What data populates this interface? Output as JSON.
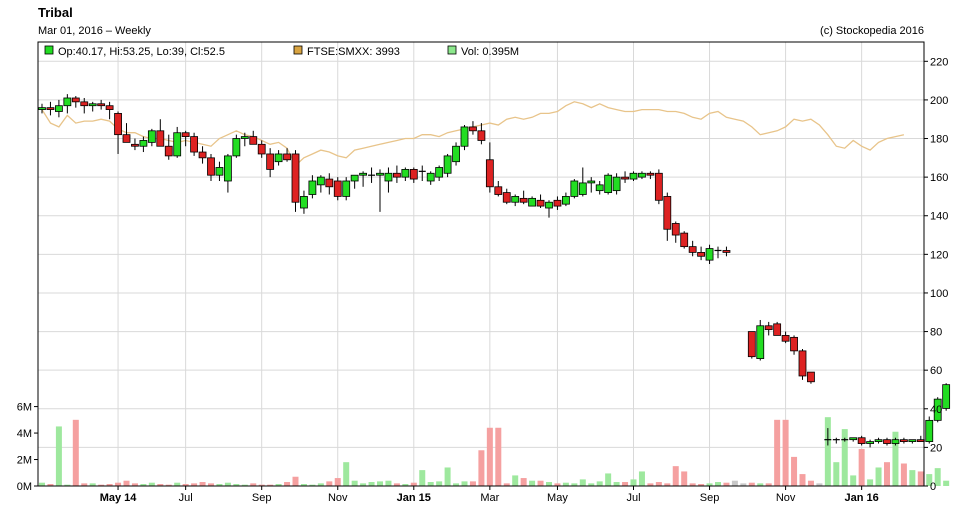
{
  "header": {
    "title": "Tribal",
    "subtitle": "Mar 01, 2016 – Weekly",
    "copyright": "(c) Stockopedia 2016"
  },
  "legend": [
    {
      "label": "Op:40.17, Hi:53.25, Lo:39, Cl:52.5",
      "color": "#22dd22"
    },
    {
      "label": "FTSE:SMXX: 3993",
      "color": "#d9a441"
    },
    {
      "label": "Vol: 0.395M",
      "color": "#8ce88c"
    }
  ],
  "colors": {
    "up": "#22dd22",
    "down": "#dd2222",
    "index_line": "#e8c48a",
    "vol_up": "#9ee89e",
    "vol_down": "#f5a0a0",
    "vol_neutral": "#c8c8c8",
    "grid": "#d9d9d9"
  },
  "chart_data": {
    "type": "candlestick",
    "price_axis": {
      "min": 0,
      "max": 230,
      "ticks": [
        0,
        20,
        40,
        60,
        80,
        100,
        120,
        140,
        160,
        180,
        200,
        220
      ]
    },
    "volume_axis": {
      "min": 0,
      "max": 6.8,
      "ticks": [
        0,
        2,
        4,
        6
      ],
      "tick_labels": [
        "0M",
        "2M",
        "4M",
        "6M"
      ]
    },
    "x_axis": {
      "labels": [
        {
          "label": "May 14",
          "week": 9,
          "bold": true
        },
        {
          "label": "Jul",
          "week": 17,
          "bold": false
        },
        {
          "label": "Sep",
          "week": 26,
          "bold": false
        },
        {
          "label": "Nov",
          "week": 35,
          "bold": false
        },
        {
          "label": "Jan 15",
          "week": 44,
          "bold": true
        },
        {
          "label": "Mar",
          "week": 53,
          "bold": false
        },
        {
          "label": "May",
          "week": 61,
          "bold": false
        },
        {
          "label": "Jul",
          "week": 70,
          "bold": false
        },
        {
          "label": "Sep",
          "week": 79,
          "bold": false
        },
        {
          "label": "Nov",
          "week": 88,
          "bold": false
        },
        {
          "label": "Jan 16",
          "week": 97,
          "bold": true
        }
      ]
    },
    "candles": [
      {
        "o": 195,
        "h": 198,
        "l": 193,
        "c": 196
      },
      {
        "o": 196,
        "h": 199,
        "l": 192,
        "c": 195
      },
      {
        "o": 194,
        "h": 200,
        "l": 191,
        "c": 197
      },
      {
        "o": 197,
        "h": 203,
        "l": 193,
        "c": 201
      },
      {
        "o": 201,
        "h": 202,
        "l": 196,
        "c": 199
      },
      {
        "o": 199,
        "h": 201,
        "l": 193,
        "c": 197
      },
      {
        "o": 197,
        "h": 199,
        "l": 194,
        "c": 198
      },
      {
        "o": 198,
        "h": 200,
        "l": 195,
        "c": 197
      },
      {
        "o": 197,
        "h": 199,
        "l": 190,
        "c": 195
      },
      {
        "o": 193,
        "h": 194,
        "l": 172,
        "c": 182
      },
      {
        "o": 182,
        "h": 188,
        "l": 179,
        "c": 178
      },
      {
        "o": 177,
        "h": 180,
        "l": 174,
        "c": 176
      },
      {
        "o": 176,
        "h": 181,
        "l": 173,
        "c": 179
      },
      {
        "o": 178,
        "h": 185,
        "l": 176,
        "c": 184
      },
      {
        "o": 184,
        "h": 190,
        "l": 178,
        "c": 176
      },
      {
        "o": 176,
        "h": 182,
        "l": 169,
        "c": 171
      },
      {
        "o": 171,
        "h": 186,
        "l": 170,
        "c": 183
      },
      {
        "o": 183,
        "h": 184,
        "l": 176,
        "c": 181
      },
      {
        "o": 181,
        "h": 183,
        "l": 171,
        "c": 173
      },
      {
        "o": 173,
        "h": 176,
        "l": 167,
        "c": 170
      },
      {
        "o": 170,
        "h": 172,
        "l": 158,
        "c": 161
      },
      {
        "o": 161,
        "h": 168,
        "l": 158,
        "c": 165
      },
      {
        "o": 158,
        "h": 172,
        "l": 152,
        "c": 171
      },
      {
        "o": 171,
        "h": 182,
        "l": 170,
        "c": 180
      },
      {
        "o": 180,
        "h": 183,
        "l": 176,
        "c": 181
      },
      {
        "o": 181,
        "h": 184,
        "l": 177,
        "c": 177
      },
      {
        "o": 177,
        "h": 179,
        "l": 170,
        "c": 172
      },
      {
        "o": 172,
        "h": 175,
        "l": 160,
        "c": 164
      },
      {
        "o": 168,
        "h": 174,
        "l": 166,
        "c": 172
      },
      {
        "o": 172,
        "h": 175,
        "l": 168,
        "c": 169
      },
      {
        "o": 172,
        "h": 174,
        "l": 142,
        "c": 147
      },
      {
        "o": 144,
        "h": 153,
        "l": 141,
        "c": 150
      },
      {
        "o": 151,
        "h": 161,
        "l": 149,
        "c": 158
      },
      {
        "o": 156,
        "h": 161,
        "l": 152,
        "c": 160
      },
      {
        "o": 159,
        "h": 162,
        "l": 151,
        "c": 155
      },
      {
        "o": 158,
        "h": 160,
        "l": 148,
        "c": 150
      },
      {
        "o": 150,
        "h": 160,
        "l": 148,
        "c": 158
      },
      {
        "o": 158,
        "h": 161,
        "l": 154,
        "c": 161
      },
      {
        "o": 161,
        "h": 163,
        "l": 155,
        "c": 162
      },
      {
        "o": 161,
        "h": 165,
        "l": 157,
        "c": 161
      },
      {
        "o": 161,
        "h": 164,
        "l": 142,
        "c": 162
      },
      {
        "o": 158,
        "h": 165,
        "l": 152,
        "c": 162
      },
      {
        "o": 162,
        "h": 166,
        "l": 157,
        "c": 160
      },
      {
        "o": 160,
        "h": 165,
        "l": 158,
        "c": 164
      },
      {
        "o": 164,
        "h": 165,
        "l": 157,
        "c": 159
      },
      {
        "o": 163,
        "h": 166,
        "l": 158,
        "c": 163
      },
      {
        "o": 158,
        "h": 163,
        "l": 156,
        "c": 162
      },
      {
        "o": 160,
        "h": 166,
        "l": 158,
        "c": 165
      },
      {
        "o": 162,
        "h": 172,
        "l": 160,
        "c": 171
      },
      {
        "o": 168,
        "h": 178,
        "l": 166,
        "c": 176
      },
      {
        "o": 176,
        "h": 187,
        "l": 174,
        "c": 186
      },
      {
        "o": 186,
        "h": 189,
        "l": 182,
        "c": 184
      },
      {
        "o": 184,
        "h": 188,
        "l": 177,
        "c": 179
      },
      {
        "o": 169,
        "h": 178,
        "l": 152,
        "c": 155
      },
      {
        "o": 155,
        "h": 158,
        "l": 150,
        "c": 151
      },
      {
        "o": 152,
        "h": 154,
        "l": 146,
        "c": 147
      },
      {
        "o": 147,
        "h": 151,
        "l": 145,
        "c": 150
      },
      {
        "o": 149,
        "h": 153,
        "l": 146,
        "c": 147
      },
      {
        "o": 145,
        "h": 150,
        "l": 145,
        "c": 149
      },
      {
        "o": 148,
        "h": 151,
        "l": 144,
        "c": 145
      },
      {
        "o": 144,
        "h": 148,
        "l": 139,
        "c": 147
      },
      {
        "o": 148,
        "h": 150,
        "l": 143,
        "c": 145
      },
      {
        "o": 146,
        "h": 152,
        "l": 145,
        "c": 150
      },
      {
        "o": 150,
        "h": 159,
        "l": 149,
        "c": 158
      },
      {
        "o": 151,
        "h": 165,
        "l": 150,
        "c": 157
      },
      {
        "o": 157,
        "h": 160,
        "l": 152,
        "c": 158
      },
      {
        "o": 153,
        "h": 158,
        "l": 151,
        "c": 156
      },
      {
        "o": 152,
        "h": 162,
        "l": 151,
        "c": 161
      },
      {
        "o": 153,
        "h": 162,
        "l": 151,
        "c": 160
      },
      {
        "o": 160,
        "h": 163,
        "l": 157,
        "c": 159
      },
      {
        "o": 159,
        "h": 163,
        "l": 158,
        "c": 162
      },
      {
        "o": 160,
        "h": 163,
        "l": 159,
        "c": 162
      },
      {
        "o": 162,
        "h": 163,
        "l": 159,
        "c": 161
      },
      {
        "o": 162,
        "h": 164,
        "l": 146,
        "c": 148
      },
      {
        "o": 150,
        "h": 152,
        "l": 127,
        "c": 133
      },
      {
        "o": 136,
        "h": 137,
        "l": 126,
        "c": 130
      },
      {
        "o": 131,
        "h": 132,
        "l": 123,
        "c": 124
      },
      {
        "o": 124,
        "h": 127,
        "l": 119,
        "c": 121
      },
      {
        "o": 121,
        "h": 124,
        "l": 117,
        "c": 119
      },
      {
        "o": 117,
        "h": 125,
        "l": 115,
        "c": 123
      },
      {
        "o": 122,
        "h": 124,
        "l": 118,
        "c": 122
      },
      {
        "o": 122,
        "h": 124,
        "l": 119,
        "c": 121
      },
      null,
      null,
      {
        "o": 80,
        "h": 80,
        "l": 66,
        "c": 67
      },
      {
        "o": 66,
        "h": 86,
        "l": 65,
        "c": 83
      },
      {
        "o": 83,
        "h": 85,
        "l": 78,
        "c": 81
      },
      {
        "o": 84,
        "h": 85,
        "l": 78,
        "c": 78
      },
      {
        "o": 78,
        "h": 80,
        "l": 74,
        "c": 75
      },
      {
        "o": 77,
        "h": 78,
        "l": 68,
        "c": 70
      },
      {
        "o": 70,
        "h": 71,
        "l": 55,
        "c": 57
      },
      {
        "o": 59,
        "h": 59,
        "l": 53,
        "c": 54
      },
      null,
      {
        "o": 24,
        "h": 30,
        "l": 21,
        "c": 24
      },
      {
        "o": 24,
        "h": 25,
        "l": 22,
        "c": 24
      },
      {
        "o": 24,
        "h": 25,
        "l": 23,
        "c": 24
      },
      {
        "o": 24,
        "h": 25,
        "l": 23,
        "c": 25
      },
      {
        "o": 25,
        "h": 26,
        "l": 21,
        "c": 22
      },
      {
        "o": 22,
        "h": 24,
        "l": 20,
        "c": 23
      },
      {
        "o": 23,
        "h": 25,
        "l": 22,
        "c": 24
      },
      {
        "o": 24,
        "h": 25,
        "l": 21,
        "c": 22
      },
      {
        "o": 22,
        "h": 25,
        "l": 21,
        "c": 24
      },
      {
        "o": 24,
        "h": 25,
        "l": 22,
        "c": 23
      },
      {
        "o": 23,
        "h": 24,
        "l": 22,
        "c": 24
      },
      {
        "o": 24,
        "h": 26,
        "l": 23,
        "c": 23
      },
      {
        "o": 23,
        "h": 36,
        "l": 22,
        "c": 34
      },
      {
        "o": 34,
        "h": 46,
        "l": 33,
        "c": 45
      },
      {
        "o": 40.17,
        "h": 53.25,
        "l": 39,
        "c": 52.5
      }
    ],
    "index_line": [
      195,
      188,
      186,
      192,
      188,
      189,
      189,
      190,
      189,
      185,
      183,
      183,
      181,
      180,
      180,
      179,
      178,
      179,
      178,
      177,
      176,
      180,
      182,
      184,
      182,
      181,
      179,
      177,
      178,
      175,
      166,
      170,
      172,
      174,
      173,
      171,
      170,
      174,
      175,
      176,
      177,
      178,
      179,
      180,
      180,
      182,
      182,
      181,
      183,
      184,
      185,
      186,
      187,
      188,
      187,
      190,
      191,
      190,
      191,
      193,
      193,
      194,
      197,
      199,
      198,
      196,
      198,
      196,
      195,
      194,
      194,
      195,
      195,
      195,
      194,
      194,
      193,
      191,
      190,
      193,
      194,
      191,
      190,
      189,
      186,
      182,
      183,
      184,
      186,
      190,
      189,
      190,
      187,
      182,
      176,
      175,
      179,
      176,
      174,
      178,
      180,
      181,
      182
    ],
    "volume": [
      0.25,
      0.15,
      4.5,
      0.1,
      5.0,
      0.2,
      0.2,
      0.1,
      0.15,
      0.25,
      0.4,
      0.2,
      0.15,
      0.25,
      0.15,
      0.1,
      0.25,
      0.15,
      0.2,
      0.3,
      0.2,
      0.15,
      0.25,
      0.15,
      0.1,
      0.2,
      0.1,
      0.1,
      0.15,
      0.3,
      0.7,
      0.15,
      0.1,
      0.2,
      0.35,
      0.6,
      1.8,
      0.4,
      0.2,
      0.3,
      0.35,
      0.4,
      0.2,
      0.15,
      0.25,
      1.2,
      0.3,
      0.35,
      1.4,
      0.2,
      0.35,
      0.35,
      2.7,
      4.4,
      4.4,
      0.2,
      0.8,
      0.6,
      0.4,
      0.4,
      0.3,
      0.2,
      0.25,
      0.2,
      0.5,
      0.2,
      0.35,
      0.95,
      0.3,
      0.3,
      0.5,
      1.1,
      0.2,
      0.3,
      0.2,
      1.5,
      1.1,
      0.2,
      0.15,
      0.2,
      0.3,
      0.25,
      0.4,
      0.2,
      0.25,
      0.2,
      0.2,
      5.0,
      5.0,
      2.2,
      0.9,
      0.4,
      0.2,
      5.2,
      1.8,
      4.3,
      0.8,
      2.8,
      0.5,
      1.4,
      1.8,
      4.1,
      1.7,
      1.2,
      1.1,
      0.9,
      1.35,
      0.4
    ]
  }
}
